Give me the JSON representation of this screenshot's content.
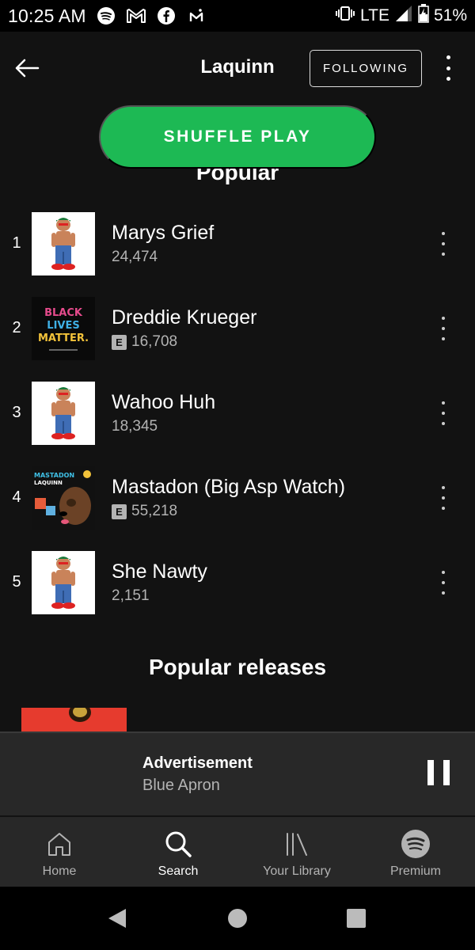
{
  "status_bar": {
    "time": "10:25 AM",
    "network": "LTE",
    "battery": "51%",
    "notification_icons": [
      "spotify-icon",
      "gmail-icon",
      "facebook-icon",
      "m-app-icon"
    ]
  },
  "header": {
    "artist_name": "Laquinn",
    "follow_label": "FOLLOWING"
  },
  "shuffle_label": "SHUFFLE PLAY",
  "popular_heading": "Popular",
  "tracks": [
    {
      "number": "1",
      "title": "Marys Grief",
      "plays": "24,474",
      "explicit": false
    },
    {
      "number": "2",
      "title": "Dreddie Krueger",
      "plays": "16,708",
      "explicit": true
    },
    {
      "number": "3",
      "title": "Wahoo Huh",
      "plays": "18,345",
      "explicit": false
    },
    {
      "number": "4",
      "title": "Mastadon (Big Asp Watch)",
      "plays": "55,218",
      "explicit": true
    },
    {
      "number": "5",
      "title": "She Nawty",
      "plays": "2,151",
      "explicit": false
    }
  ],
  "explicit_badge": "E",
  "artwork_text": {
    "blm": [
      "BLACK",
      "LIVES",
      "MATTER."
    ],
    "mastadon": [
      "MASTADON",
      "LAQUINN"
    ]
  },
  "releases_heading": "Popular releases",
  "now_playing": {
    "title": "Advertisement",
    "subtitle": "Blue Apron"
  },
  "bottom_nav": [
    {
      "label": "Home",
      "icon": "home-icon",
      "active": false
    },
    {
      "label": "Search",
      "icon": "search-icon",
      "active": true
    },
    {
      "label": "Your Library",
      "icon": "library-icon",
      "active": false
    },
    {
      "label": "Premium",
      "icon": "spotify-icon",
      "active": false
    }
  ],
  "colors": {
    "accent": "#1db954",
    "background": "#121212",
    "bar": "#282828",
    "muted_text": "#b3b3b3"
  }
}
